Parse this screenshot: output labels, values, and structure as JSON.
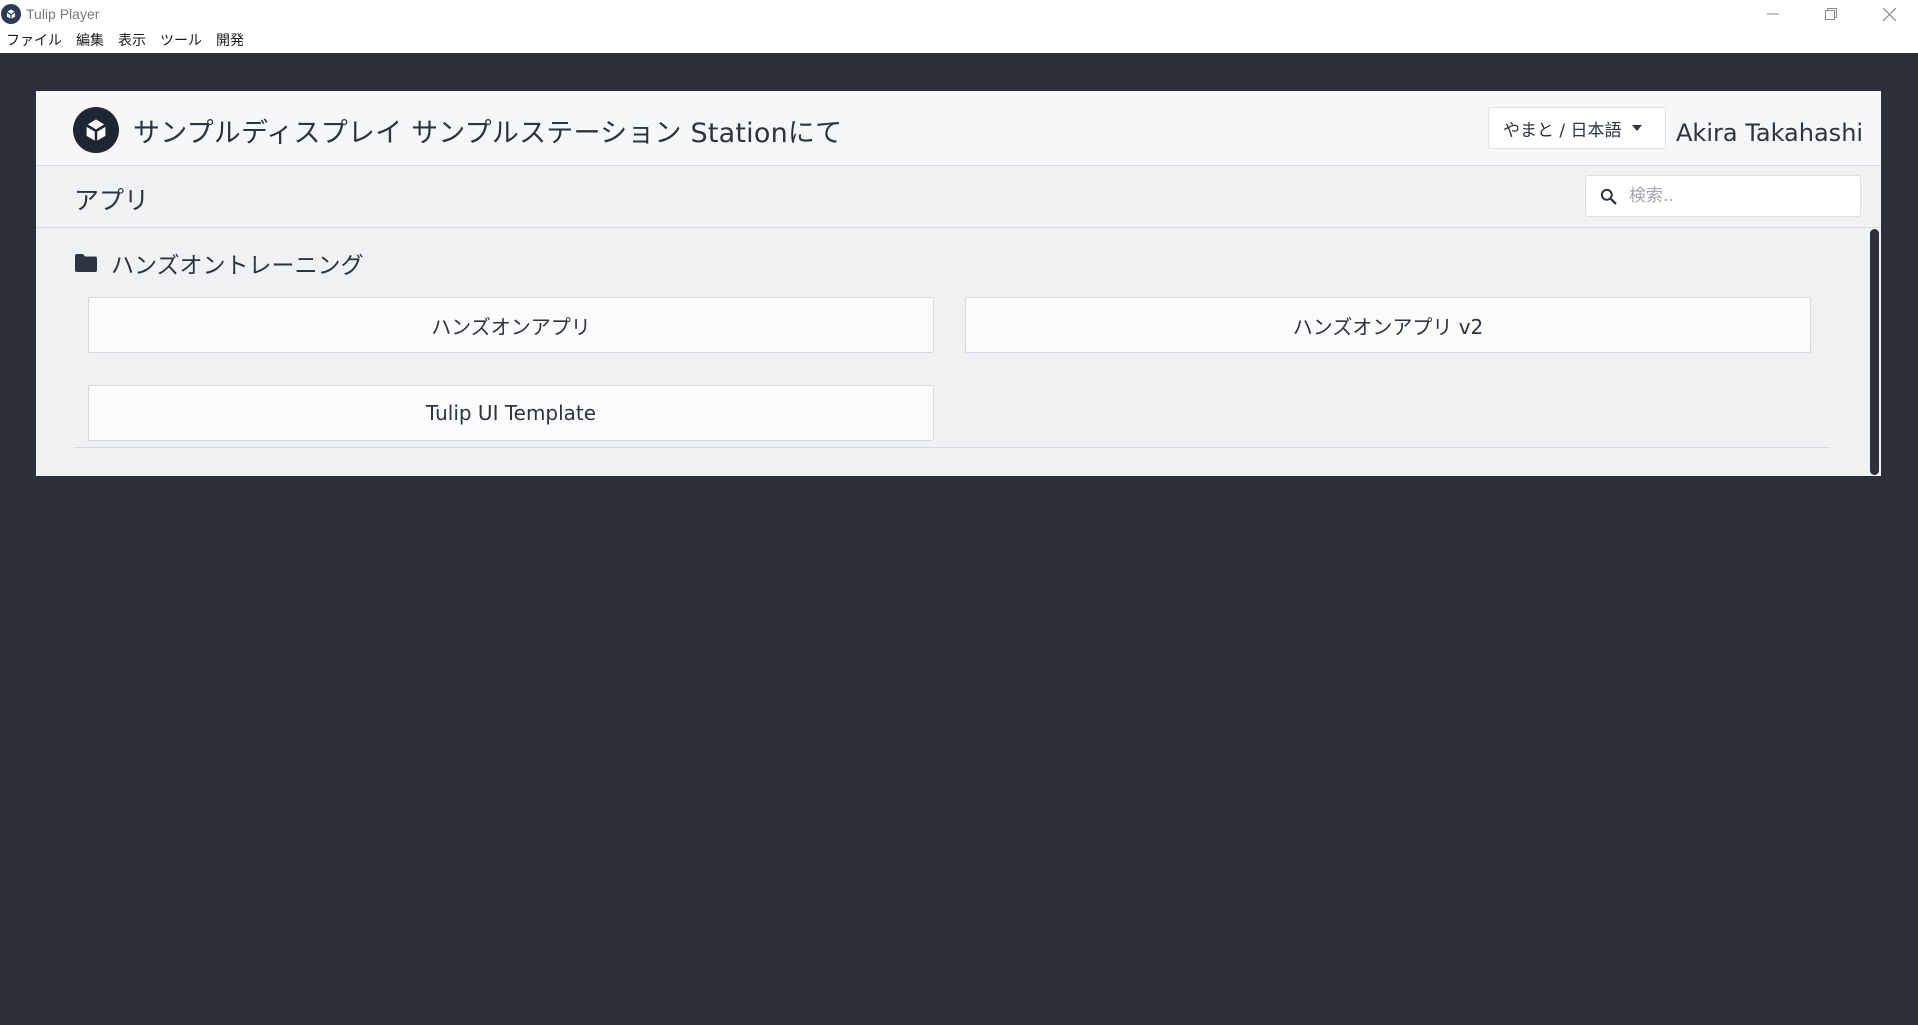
{
  "window": {
    "title": "Tulip Player",
    "controls": [
      "minimize-icon",
      "restore-icon",
      "close-icon"
    ]
  },
  "menu": {
    "items": [
      "ファイル",
      "編集",
      "表示",
      "ツール",
      "開発"
    ]
  },
  "header": {
    "station_title": "サンプルディスプレイ サンプルステーション Stationにて",
    "language_selector": "やまと / 日本語",
    "user_name": "Akira Takahashi"
  },
  "apps_bar": {
    "title": "アプリ",
    "search_placeholder": "検索.."
  },
  "folder": {
    "name": "ハンズオントレーニング",
    "apps": [
      "ハンズオンアプリ",
      "ハンズオンアプリ v2",
      "Tulip UI Template"
    ]
  },
  "colors": {
    "background": "#2b303b",
    "card": "#f0f1f3",
    "header": "#f6f7f9",
    "text": "#2d3340",
    "logo": "#1f2633"
  }
}
